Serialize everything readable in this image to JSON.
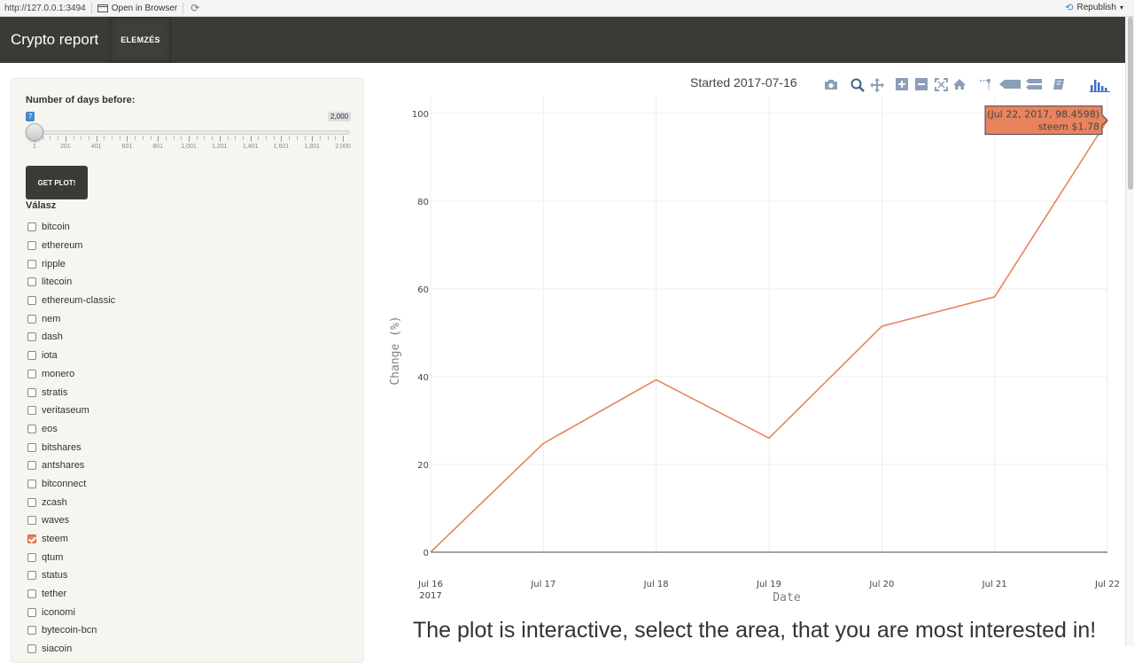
{
  "viewer": {
    "url": "http://127.0.0.1:3494",
    "open_in_browser": "Open in Browser",
    "republish": "Republish"
  },
  "navbar": {
    "brand": "Crypto report",
    "tab": "ELEMZÉS"
  },
  "sidebar": {
    "slider_label": "Number of days before:",
    "slider_value": "7",
    "slider_max_label": "2,000",
    "slider_min": 1,
    "slider_max": 2000,
    "tick_labels": [
      "1",
      "201",
      "401",
      "601",
      "801",
      "1,001",
      "1,201",
      "1,401",
      "1,601",
      "1,801",
      "2,000"
    ],
    "button_label": "GET PLOT!",
    "group_label": "Válasz",
    "coins": [
      {
        "label": "bitcoin",
        "checked": false
      },
      {
        "label": "ethereum",
        "checked": false
      },
      {
        "label": "ripple",
        "checked": false
      },
      {
        "label": "litecoin",
        "checked": false
      },
      {
        "label": "ethereum-classic",
        "checked": false
      },
      {
        "label": "nem",
        "checked": false
      },
      {
        "label": "dash",
        "checked": false
      },
      {
        "label": "iota",
        "checked": false
      },
      {
        "label": "monero",
        "checked": false
      },
      {
        "label": "stratis",
        "checked": false
      },
      {
        "label": "veritaseum",
        "checked": false
      },
      {
        "label": "eos",
        "checked": false
      },
      {
        "label": "bitshares",
        "checked": false
      },
      {
        "label": "antshares",
        "checked": false
      },
      {
        "label": "bitconnect",
        "checked": false
      },
      {
        "label": "zcash",
        "checked": false
      },
      {
        "label": "waves",
        "checked": false
      },
      {
        "label": "steem",
        "checked": true
      },
      {
        "label": "qtum",
        "checked": false
      },
      {
        "label": "status",
        "checked": false
      },
      {
        "label": "tether",
        "checked": false
      },
      {
        "label": "iconomi",
        "checked": false
      },
      {
        "label": "bytecoin-bcn",
        "checked": false
      },
      {
        "label": "siacoin",
        "checked": false
      }
    ]
  },
  "modebar_icons": [
    "camera-icon",
    "zoom-icon",
    "pan-icon",
    "zoom-in-icon",
    "zoom-out-icon",
    "autoscale-icon",
    "reset-axes-icon",
    "spike-lines-icon",
    "hover-closest-icon",
    "hover-compare-icon",
    "edit-in-chart-studio-icon",
    "plotly-logo-icon"
  ],
  "chart_data": {
    "type": "line",
    "title": "Started 2017-07-16",
    "xlabel": "Date",
    "ylabel": "Change (%)",
    "x": [
      "2017-07-16",
      "2017-07-17",
      "2017-07-18",
      "2017-07-19",
      "2017-07-20",
      "2017-07-21",
      "2017-07-22"
    ],
    "x_tick_labels": [
      "Jul 16\n2017",
      "Jul 17",
      "Jul 18",
      "Jul 19",
      "Jul 20",
      "Jul 21",
      "Jul 22"
    ],
    "series": [
      {
        "name": "steem",
        "values": [
          0,
          24.8,
          39.3,
          26.0,
          51.5,
          58.2,
          98.4598
        ],
        "color": "#e8835e"
      }
    ],
    "y_ticks": [
      0,
      20,
      40,
      60,
      80,
      100
    ],
    "ylim": [
      0,
      100
    ],
    "grid": true,
    "hover_label": {
      "line1": "(Jul 22, 2017, 98.4598)",
      "line2": "steem $1.78"
    }
  },
  "caption": "The plot is interactive, select the area, that you are most interested in!"
}
